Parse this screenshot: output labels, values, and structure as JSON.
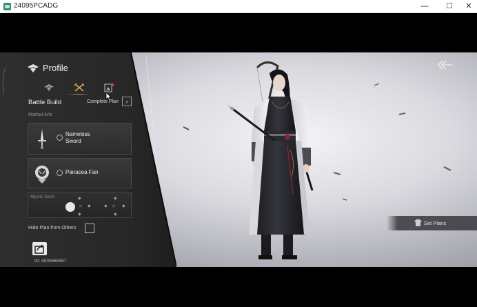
{
  "window": {
    "title": "24095PCADG",
    "min_glyph": "—",
    "max_glyph": "☐",
    "close_glyph": "✕"
  },
  "profile": {
    "title": "Profile",
    "battle_build": "Battle Build",
    "complete_plan": "Complete Plan",
    "complete_plan_arrow": "›",
    "martial_arts_label": "Martial Arts",
    "martial_arts": [
      {
        "name": "Nameless Sword",
        "icon": "sword-icon"
      },
      {
        "name": "Panacea Fan",
        "icon": "fan-icon"
      }
    ],
    "mystic_skills_label": "Mystic Skills",
    "hide_plan_label": "Hide Plan from Others",
    "hide_plan_checked": false,
    "player_id": "ID: 4039566987"
  },
  "set_plans": "Set Plans",
  "colors": {
    "accent": "#d9a55b",
    "panel": "#2b2b2b"
  }
}
